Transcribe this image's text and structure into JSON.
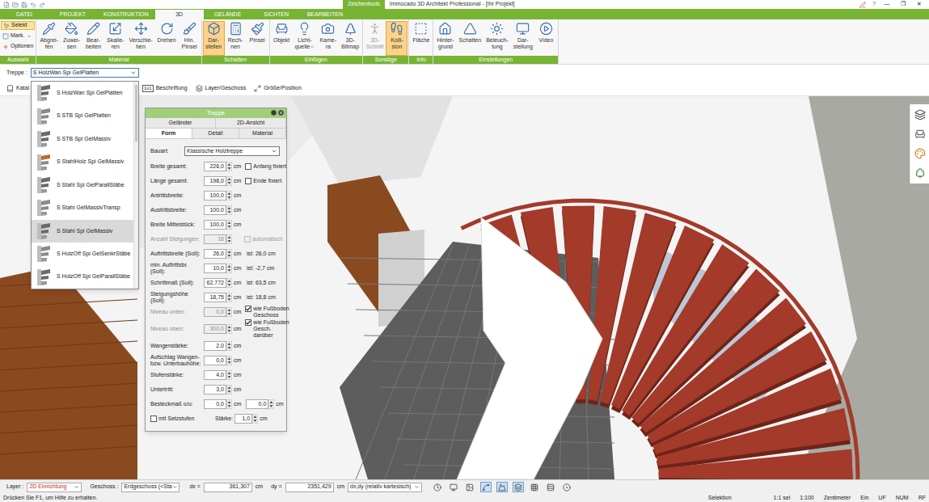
{
  "window": {
    "title": "Immocado 3D Architekt Professional - [Ihr Projekt]",
    "context_tab": "Zeichentools",
    "help": "?",
    "controls": [
      "—",
      "❐",
      "✕"
    ]
  },
  "ribbon_tabs": [
    {
      "label": "DATEI",
      "selected": false
    },
    {
      "label": "PROJEKT",
      "selected": false
    },
    {
      "label": "KONSTRUKTION",
      "selected": false
    },
    {
      "label": "3D",
      "selected": true
    },
    {
      "label": "GELÄNDE",
      "selected": false
    },
    {
      "label": "SICHTEN",
      "selected": false
    },
    {
      "label": "BEARBEITEN",
      "selected": false
    }
  ],
  "ribbon_groups": [
    {
      "label": "Auswahl",
      "kind": "small",
      "items": [
        {
          "lines": [
            "Selekt"
          ],
          "selected": true,
          "disabled": false,
          "dropdown": false
        },
        {
          "lines": [
            "Mark."
          ],
          "selected": false,
          "disabled": false,
          "dropdown": true
        },
        {
          "lines": [
            "Optionen"
          ],
          "selected": false,
          "disabled": false,
          "dropdown": false
        }
      ]
    },
    {
      "label": "Material",
      "kind": "large",
      "items": [
        {
          "lines": [
            "Abgrei-",
            "fen"
          ],
          "selected": false,
          "disabled": false,
          "dropdown": false
        },
        {
          "lines": [
            "Zuwei-",
            "sen"
          ],
          "selected": false,
          "disabled": false,
          "dropdown": false
        },
        {
          "lines": [
            "Bear-",
            "beiten"
          ],
          "selected": false,
          "disabled": false,
          "dropdown": false
        },
        {
          "lines": [
            "Skalie-",
            "ren"
          ],
          "selected": false,
          "disabled": false,
          "dropdown": false
        },
        {
          "lines": [
            "Verschie-",
            "ben"
          ],
          "selected": false,
          "disabled": false,
          "dropdown": false
        },
        {
          "lines": [
            "Drehen"
          ],
          "selected": false,
          "disabled": false,
          "dropdown": false
        },
        {
          "lines": [
            "Hin.",
            "Pinsel"
          ],
          "selected": false,
          "disabled": false,
          "dropdown": false
        }
      ]
    },
    {
      "label": "Schatten",
      "kind": "large",
      "items": [
        {
          "lines": [
            "Dar-",
            "stellen"
          ],
          "selected": true,
          "disabled": false,
          "dropdown": false
        },
        {
          "lines": [
            "Rech-",
            "nen"
          ],
          "selected": false,
          "disabled": false,
          "dropdown": false
        },
        {
          "lines": [
            "Pinsel"
          ],
          "selected": false,
          "disabled": false,
          "dropdown": false
        }
      ]
    },
    {
      "label": "Einfügen",
      "kind": "large",
      "items": [
        {
          "lines": [
            "Objekt"
          ],
          "selected": false,
          "disabled": false,
          "dropdown": false
        },
        {
          "lines": [
            "Licht-",
            "quelle"
          ],
          "selected": false,
          "disabled": false,
          "dropdown": true
        },
        {
          "lines": [
            "Kame-",
            "ra"
          ],
          "selected": false,
          "disabled": false,
          "dropdown": false
        },
        {
          "lines": [
            "3D-",
            "Bitmap"
          ],
          "selected": false,
          "disabled": false,
          "dropdown": false
        }
      ]
    },
    {
      "label": "Sonstige",
      "kind": "large",
      "items": [
        {
          "lines": [
            "3D-",
            "Schnitt"
          ],
          "selected": false,
          "disabled": true,
          "dropdown": false
        },
        {
          "lines": [
            "Kolli-",
            "sion"
          ],
          "selected": true,
          "disabled": false,
          "dropdown": false
        }
      ]
    },
    {
      "label": "Info",
      "kind": "large",
      "items": [
        {
          "lines": [
            "Fläche"
          ],
          "selected": false,
          "disabled": false,
          "dropdown": false
        }
      ]
    },
    {
      "label": "Einstellungen",
      "kind": "large",
      "items": [
        {
          "lines": [
            "Hinter-",
            "grund"
          ],
          "selected": false,
          "disabled": false,
          "dropdown": false
        },
        {
          "lines": [
            "Schatten"
          ],
          "selected": false,
          "disabled": false,
          "dropdown": false
        },
        {
          "lines": [
            "Beleuch-",
            "tung"
          ],
          "selected": false,
          "disabled": false,
          "dropdown": false
        },
        {
          "lines": [
            "Dar-",
            "stellung"
          ],
          "selected": false,
          "disabled": false,
          "dropdown": false
        },
        {
          "lines": [
            "Video"
          ],
          "selected": false,
          "disabled": false,
          "dropdown": false
        }
      ]
    }
  ],
  "stair_selector": {
    "label": "Treppe :",
    "value": "S HolzWan Spi GelPlatten",
    "expanded": true,
    "options": [
      {
        "label": "S HolzWan Spi GelPlatten",
        "selected": false
      },
      {
        "label": "S STB Spi GelPlatten",
        "selected": false
      },
      {
        "label": "S STB Spi GelMassiv",
        "selected": false
      },
      {
        "label": "S StahlHolz Spi GelMassiv",
        "selected": false
      },
      {
        "label": "S Stahl Spi GelParallStäbe",
        "selected": false
      },
      {
        "label": "S Stahl GelMassivTransp",
        "selected": false
      },
      {
        "label": "S Stahl Spi GelMassiv",
        "selected": true
      },
      {
        "label": "S HolzOff Spi GelSenkrStäbe",
        "selected": false
      },
      {
        "label": "S HolzOff Spi GelParallStäbe",
        "selected": false
      }
    ]
  },
  "toolbar": [
    {
      "icon_text": "",
      "label": "Katal"
    },
    {
      "icon_text": "1x1",
      "label": "Beschriftung"
    },
    {
      "icon_text": "",
      "label": "Layer/Geschoss"
    },
    {
      "icon_text": "",
      "label": "Größe/Position"
    }
  ],
  "panel": {
    "title": "Treppe",
    "tabs_row1": [
      {
        "label": "Geländer",
        "selected": false
      },
      {
        "label": "2D-Ansicht",
        "selected": false
      }
    ],
    "tabs_row2": [
      {
        "label": "Form",
        "selected": true
      },
      {
        "label": "Detail",
        "selected": false
      },
      {
        "label": "Material",
        "selected": false
      }
    ],
    "bauart": {
      "label": "Bauart:",
      "value": "Klassische Holztreppe"
    },
    "rows": [
      {
        "label": "Breite gesamt:",
        "value": "226,0",
        "unit": "cm",
        "disabled": false,
        "ist": "",
        "check": {
          "label": "Anfang fixiert",
          "checked": false,
          "disabled": false
        },
        "value2": "",
        "unit2": ""
      },
      {
        "label": "Länge gesamt:",
        "value": "198,0",
        "unit": "cm",
        "disabled": false,
        "ist": "",
        "check": {
          "label": "Ende fixiert",
          "checked": false,
          "disabled": false
        },
        "value2": "",
        "unit2": ""
      },
      {
        "label": "Antrittsbreite:",
        "value": "100,0",
        "unit": "cm",
        "disabled": false,
        "ist": "",
        "check": null,
        "value2": "",
        "unit2": ""
      },
      {
        "label": "Austrittsbreite:",
        "value": "100,0",
        "unit": "cm",
        "disabled": false,
        "ist": "",
        "check": null,
        "value2": "",
        "unit2": ""
      },
      {
        "label": "Breite Mittelstück:",
        "value": "100,0",
        "unit": "cm",
        "disabled": false,
        "ist": "",
        "check": null,
        "value2": "",
        "unit2": ""
      },
      {
        "label": "Anzahl Steigungen:",
        "value": "16",
        "unit": "",
        "disabled": true,
        "ist": "",
        "check": {
          "label": "automatisch",
          "checked": false,
          "disabled": true
        },
        "value2": "",
        "unit2": ""
      },
      {
        "label": "Auftrittsbreite (Soll):",
        "value": "26,0",
        "unit": "cm",
        "disabled": false,
        "ist": "ist: 26,0 cm",
        "check": null,
        "value2": "",
        "unit2": ""
      },
      {
        "label": "min. Auftrittsbr. (Soll):",
        "value": "10,0",
        "unit": "cm",
        "disabled": false,
        "ist": "ist: -2,7 cm",
        "check": null,
        "value2": "",
        "unit2": ""
      },
      {
        "label": "Schrittmaß (Soll):",
        "value": "62,772",
        "unit": "cm",
        "disabled": false,
        "ist": "ist: 63,5 cm",
        "check": null,
        "value2": "",
        "unit2": ""
      },
      {
        "label": "Steigungshöhe (Soll):",
        "value": "18,75",
        "unit": "cm",
        "disabled": false,
        "ist": "ist: 18,8 cm",
        "check": null,
        "value2": "",
        "unit2": ""
      },
      {
        "label": "Niveau unten:",
        "value": "0,0",
        "unit": "cm",
        "disabled": true,
        "ist": "",
        "check": {
          "label": "wie Fußboden Geschoss",
          "checked": true,
          "disabled": false
        },
        "value2": "",
        "unit2": ""
      },
      {
        "label": "Niveau oben:",
        "value": "300,0",
        "unit": "cm",
        "disabled": true,
        "ist": "",
        "check": {
          "label": "wie Fußboden Gesch. darüber",
          "checked": true,
          "disabled": false
        },
        "value2": "",
        "unit2": ""
      },
      {
        "label": "Wangenstärke:",
        "value": "2,0",
        "unit": "cm",
        "disabled": false,
        "ist": "",
        "check": null,
        "value2": "",
        "unit2": ""
      },
      {
        "label": "Aufschlag Wangen-bzw. Unterbauhöhe:",
        "value": "0,0",
        "unit": "cm",
        "disabled": false,
        "ist": "",
        "check": null,
        "value2": "",
        "unit2": ""
      },
      {
        "label": "Stufenstärke:",
        "value": "4,0",
        "unit": "cm",
        "disabled": false,
        "ist": "",
        "check": null,
        "value2": "",
        "unit2": ""
      },
      {
        "label": "Untertritt:",
        "value": "3,0",
        "unit": "cm",
        "disabled": false,
        "ist": "",
        "check": null,
        "value2": "",
        "unit2": ""
      },
      {
        "label": "Besteckmaß o/u:",
        "value": "0,0",
        "unit": "cm",
        "disabled": false,
        "ist": "",
        "check": null,
        "value2": "0,0",
        "unit2": "cm"
      }
    ],
    "setzstufen": {
      "label": "mit Setzstufen",
      "checked": false,
      "staerke_label": "Stärke:",
      "value": "1,0",
      "unit": "cm"
    }
  },
  "status_bar": {
    "layer_label": "Layer :",
    "layer": "2D Einrichtung",
    "geschoss_label": "Geschoss :",
    "geschoss": "Erdgeschoss (<Sta",
    "dx_label": "dx =",
    "dx": "361,307",
    "dx_unit": "cm",
    "dy_label": "dy =",
    "dy": "2351,429",
    "dy_unit": "cm",
    "mode": "dx,dy (relativ kartesisch)",
    "tools": [
      {
        "selected": false
      },
      {
        "selected": false
      },
      {
        "selected": false
      },
      {
        "selected": true
      },
      {
        "selected": true
      },
      {
        "selected": true
      },
      {
        "selected": false
      },
      {
        "selected": false
      },
      {
        "selected": false
      }
    ],
    "hint": "Drücken Sie F1, um Hilfe zu erhalten.",
    "indicators": [
      "Selektion",
      "1:1 sel",
      "1:100",
      "Zentimeter",
      "Ein",
      "UF",
      "NUM",
      "RF"
    ]
  }
}
